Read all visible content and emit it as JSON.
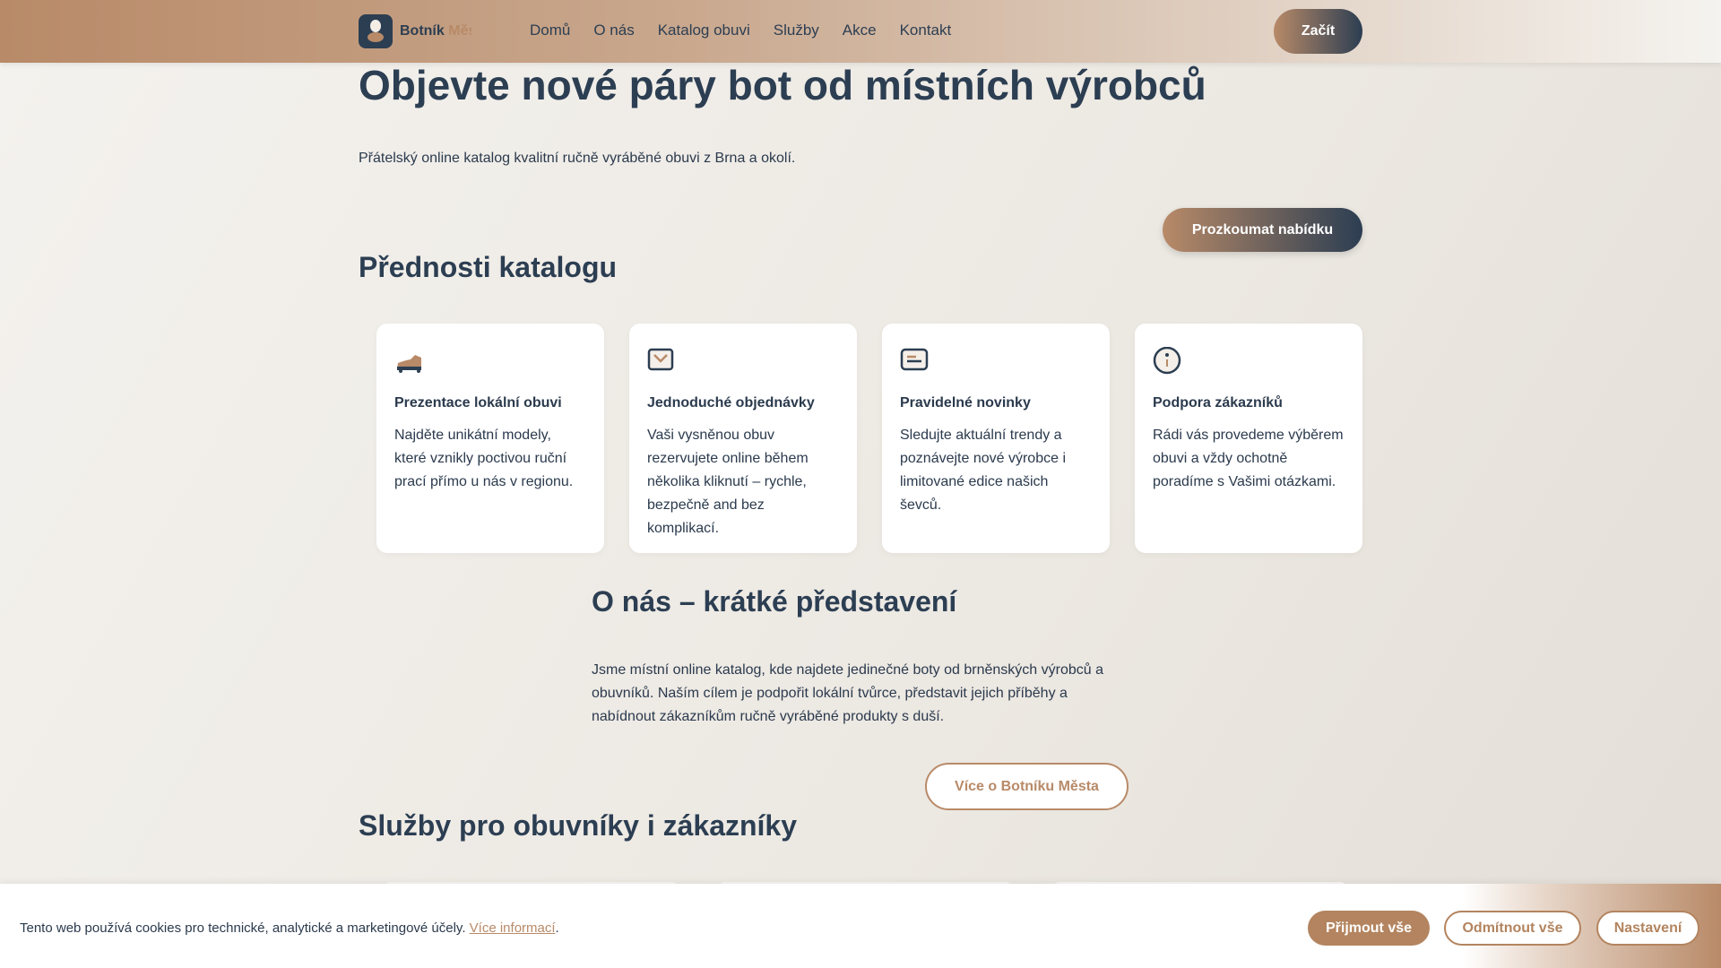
{
  "header": {
    "brand_main": "Botník",
    "brand_accent": "Města",
    "nav": [
      "Domů",
      "O nás",
      "Katalog obuvi",
      "Služby",
      "Akce",
      "Kontakt"
    ],
    "cta": "Začít"
  },
  "hero": {
    "title": "Objevte nové páry bot od místních výrobců",
    "subtitle": "Přátelský online katalog kvalitní ručně vyráběné obuvi z Brna a okolí.",
    "cta": "Prozkoumat nabídku"
  },
  "features": {
    "title": "Přednosti katalogu",
    "items": [
      {
        "icon": "shoe-icon",
        "title": "Prezentace lokální obuvi",
        "text": "Najděte unikátní modely, které vznikly poctivou ruční prací přímo u nás v regionu."
      },
      {
        "icon": "mail-icon",
        "title": "Jednoduché objednávky",
        "text": "Vaši vysněnou obuv rezervujete online během několika kliknutí – rychle, bezpečně and bez komplikací."
      },
      {
        "icon": "news-icon",
        "title": "Pravidelné novinky",
        "text": "Sledujte aktuální trendy a poznávejte nové výrobce i limitované edice našich ševců."
      },
      {
        "icon": "info-icon",
        "title": "Podpora zákazníků",
        "text": "Rádi vás provedeme výběrem obuvi a vždy ochotně poradíme s Vašimi otázkami."
      }
    ]
  },
  "about": {
    "title": "O nás – krátké představení",
    "text": "Jsme místní online katalog, kde najdete jedinečné boty od brněnských výrobců a obuvníků. Naším cílem je podpořit lokální tvůrce, představit jejich příběhy a nabídnout zákazníkům ručně vyráběné produkty s duší.",
    "cta": "Více o Botníku Města"
  },
  "services": {
    "title": "Služby pro obuvníky i zákazníky"
  },
  "cookie": {
    "text": "Tento web používá cookies pro technické, analytické a marketingové účely.",
    "link": "Více informací",
    "accept": "Přijmout vše",
    "reject": "Odmítnout vše",
    "settings": "Nastavení"
  },
  "colors": {
    "primary": "#2c3e52",
    "accent": "#b88a68"
  }
}
